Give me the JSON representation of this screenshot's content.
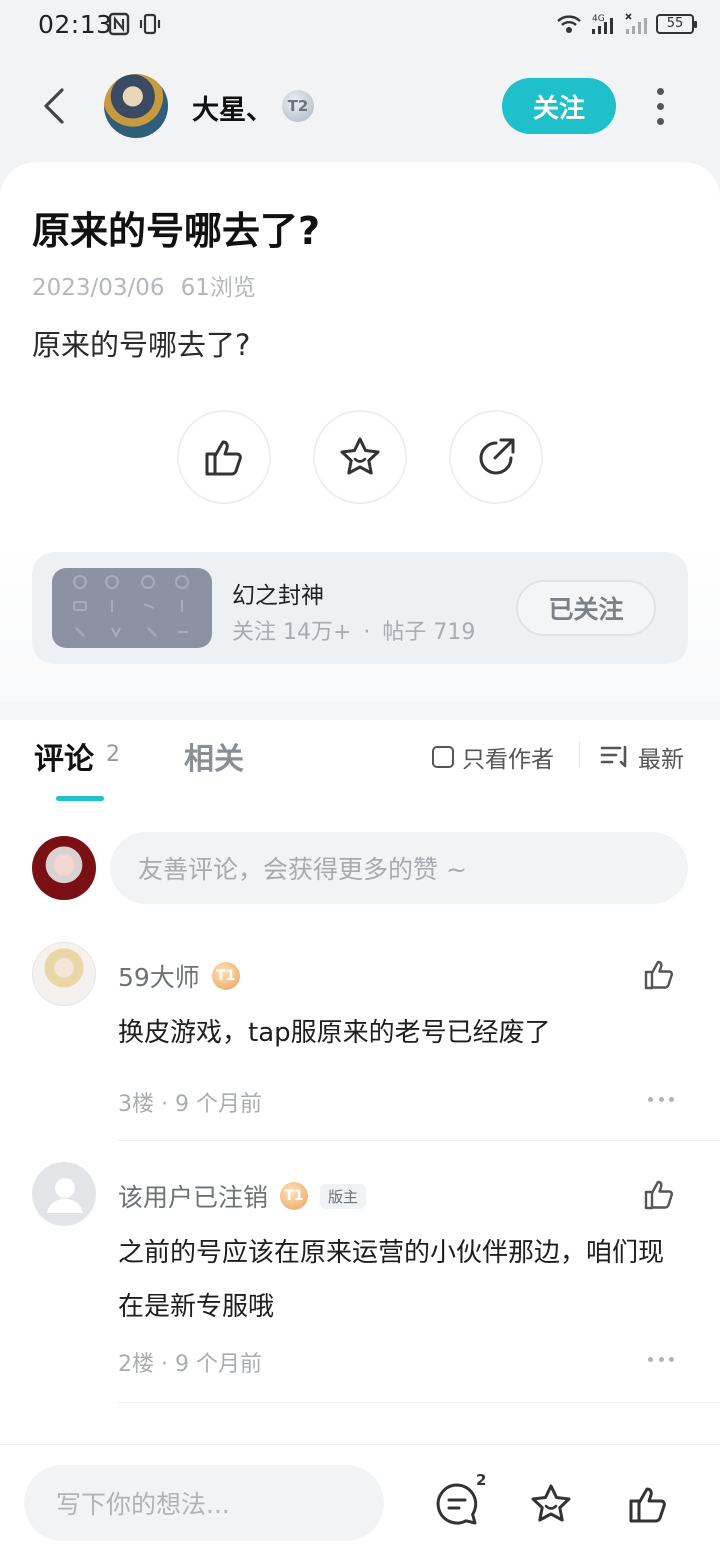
{
  "status_bar": {
    "time": "02:13",
    "battery": "55"
  },
  "header": {
    "author_name": "大星、",
    "level_badge": "T2",
    "follow_label": "关注"
  },
  "post": {
    "title": "原来的号哪去了?",
    "date": "2023/03/06",
    "views": "61浏览",
    "body": "原来的号哪去了?"
  },
  "forum": {
    "name": "幻之封神",
    "followers": "关注 14万+",
    "separator": "·",
    "posts": "帖子 719",
    "followed_label": "已关注"
  },
  "tabs": {
    "comments_label": "评论",
    "comments_count": "2",
    "related_label": "相关",
    "author_only_label": "只看作者",
    "sort_label": "最新"
  },
  "comment_input": {
    "placeholder": "友善评论，会获得更多的赞 ~"
  },
  "comments": [
    {
      "name": "59大师",
      "level": "T1",
      "text": "换皮游戏，tap服原来的老号已经废了",
      "floor": "3楼 · 9 个月前"
    },
    {
      "name": "该用户已注销",
      "level": "T1",
      "badge": "版主",
      "text": "之前的号应该在原来运营的小伙伴那边，咱们现在是新专服哦",
      "floor": "2楼 · 9 个月前"
    }
  ],
  "bottom_bar": {
    "placeholder": "写下你的想法...",
    "comment_count": "2"
  },
  "colors": {
    "accent": "#1fc0c9",
    "coin": "#e9a35c"
  }
}
